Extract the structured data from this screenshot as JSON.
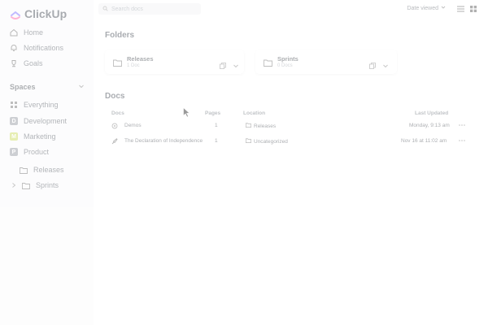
{
  "app": {
    "name": "ClickUp"
  },
  "sidebar": {
    "nav": [
      {
        "label": "Home",
        "icon": "home-icon"
      },
      {
        "label": "Notifications",
        "icon": "bell-icon"
      },
      {
        "label": "Goals",
        "icon": "trophy-icon"
      }
    ],
    "spaces_title": "Spaces",
    "spaces": [
      {
        "label": "Everything",
        "badge": "",
        "color": "#8a8f98"
      },
      {
        "label": "Development",
        "badge": "D",
        "color": "#8a8f98"
      },
      {
        "label": "Marketing",
        "badge": "M",
        "color": "#c4d94a"
      },
      {
        "label": "Product",
        "badge": "P",
        "color": "#8a8f98"
      }
    ],
    "folders": [
      {
        "label": "Releases"
      },
      {
        "label": "Sprints"
      }
    ]
  },
  "topbar": {
    "search_placeholder": "Search docs",
    "sort_label": "Date viewed"
  },
  "folders": {
    "title": "Folders",
    "items": [
      {
        "name": "Releases",
        "count": "1 Doc"
      },
      {
        "name": "Sprints",
        "count": "0 Docs"
      }
    ]
  },
  "docs": {
    "title": "Docs",
    "columns": {
      "name": "Docs",
      "pages": "Pages",
      "location": "Location",
      "updated": "Last Updated"
    },
    "rows": [
      {
        "name": "Demos",
        "pages": "1",
        "location": "Releases",
        "updated": "Monday, 9:13 am"
      },
      {
        "name": "The Declaration of Independence",
        "pages": "1",
        "location": "Uncategorized",
        "updated": "Nov 16 at 11:02 am"
      }
    ]
  }
}
